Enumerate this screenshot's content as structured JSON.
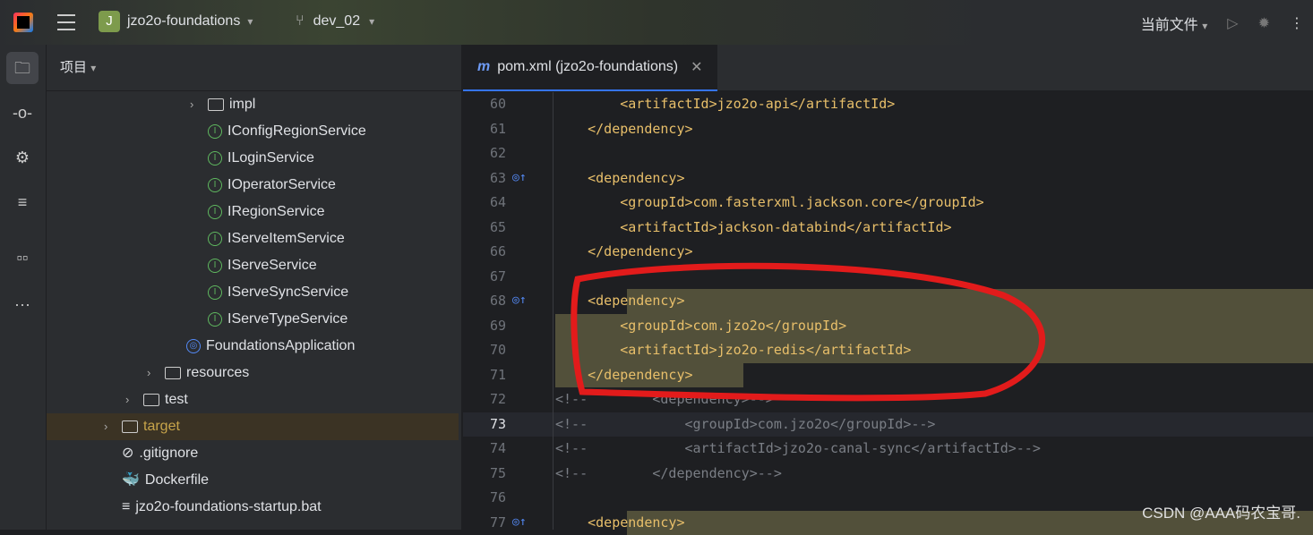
{
  "header": {
    "project_initial": "J",
    "project": "jzo2o-foundations",
    "branch": "dev_02",
    "run_config": "当前文件"
  },
  "panel": {
    "title": "项目"
  },
  "tree": [
    {
      "label": "impl",
      "type": "folder",
      "indent": 1,
      "arrow": true
    },
    {
      "label": "IConfigRegionService",
      "type": "interface",
      "indent": 1
    },
    {
      "label": "ILoginService",
      "type": "interface",
      "indent": 1
    },
    {
      "label": "IOperatorService",
      "type": "interface",
      "indent": 1
    },
    {
      "label": "IRegionService",
      "type": "interface",
      "indent": 1
    },
    {
      "label": "IServeItemService",
      "type": "interface",
      "indent": 1
    },
    {
      "label": "IServeService",
      "type": "interface",
      "indent": 1
    },
    {
      "label": "IServeSyncService",
      "type": "interface",
      "indent": 1
    },
    {
      "label": "IServeTypeService",
      "type": "interface",
      "indent": 1
    },
    {
      "label": "FoundationsApplication",
      "type": "app",
      "indent": 0
    },
    {
      "label": "resources",
      "type": "folder",
      "indent": -1,
      "arrow": true
    },
    {
      "label": "test",
      "type": "folder",
      "indent": -2,
      "arrow": true
    },
    {
      "label": "target",
      "type": "folder",
      "indent": -3,
      "arrow": true
    },
    {
      "label": ".gitignore",
      "type": "ignore",
      "indent": -3
    },
    {
      "label": "Dockerfile",
      "type": "docker",
      "indent": -3
    },
    {
      "label": "jzo2o-foundations-startup.bat",
      "type": "text",
      "indent": -3
    }
  ],
  "editor": {
    "tab": "pom.xml (jzo2o-foundations)",
    "tab_icon": "m",
    "lines": [
      {
        "n": "60",
        "text": "        <artifactId>jzo2o-api</artifactId>"
      },
      {
        "n": "61",
        "text": "    </dependency>"
      },
      {
        "n": "62",
        "text": ""
      },
      {
        "n": "63",
        "text": "    <dependency>",
        "gutter": true
      },
      {
        "n": "64",
        "text": "        <groupId>com.fasterxml.jackson.core</groupId>"
      },
      {
        "n": "65",
        "text": "        <artifactId>jackson-databind</artifactId>"
      },
      {
        "n": "66",
        "text": "    </dependency>"
      },
      {
        "n": "67",
        "text": ""
      },
      {
        "n": "68",
        "text": "    <dependency>",
        "gutter": true
      },
      {
        "n": "69",
        "text": "        <groupId>com.jzo2o</groupId>"
      },
      {
        "n": "70",
        "text": "        <artifactId>jzo2o-redis</artifactId>"
      },
      {
        "n": "71",
        "text": "    </dependency>"
      },
      {
        "n": "72",
        "text": "<!--        <dependency>-->",
        "comment": true
      },
      {
        "n": "73",
        "text": "<!--            <groupId>com.jzo2o</groupId>-->",
        "comment": true
      },
      {
        "n": "74",
        "text": "<!--            <artifactId>jzo2o-canal-sync</artifactId>-->",
        "comment": true
      },
      {
        "n": "75",
        "text": "<!--        </dependency>-->",
        "comment": true
      },
      {
        "n": "76",
        "text": ""
      },
      {
        "n": "77",
        "text": "    <dependency>",
        "gutter": true
      }
    ]
  },
  "watermark": "CSDN @AAA码农宝哥."
}
